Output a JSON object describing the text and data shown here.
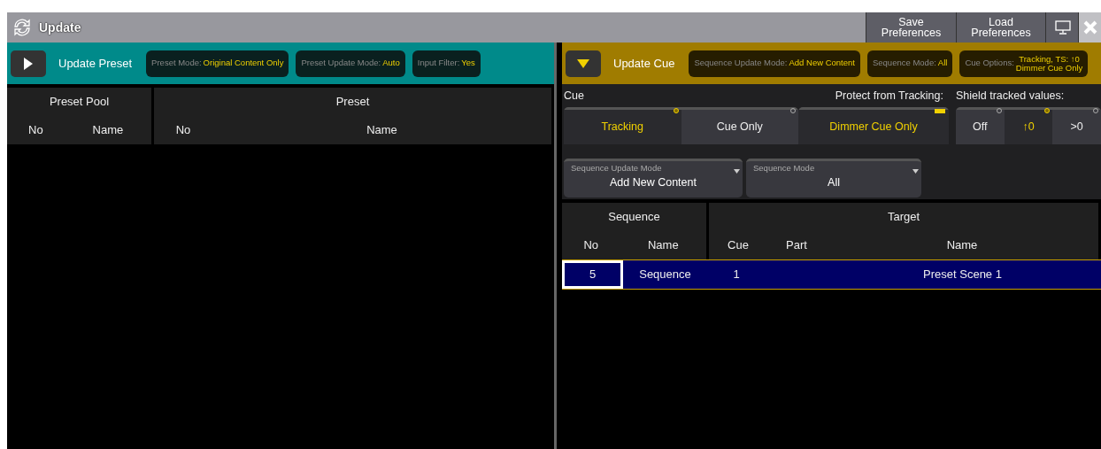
{
  "window": {
    "title": "Update",
    "buttons": [
      {
        "kind": "text",
        "label": "Save Preferences"
      },
      {
        "kind": "text",
        "label": "Load Preferences"
      },
      {
        "kind": "monitor"
      },
      {
        "kind": "close"
      }
    ]
  },
  "preset_panel": {
    "title": "Update Preset",
    "expanded": false,
    "chips": [
      {
        "label": "Preset Mode:",
        "value": "Original Content Only"
      },
      {
        "label": "Preset Update Mode:",
        "value": "Auto"
      },
      {
        "label": "Input Filter:",
        "value": "Yes"
      }
    ],
    "table": {
      "groups": [
        {
          "title": "Preset Pool",
          "columns": [
            "No",
            "Name"
          ]
        },
        {
          "title": "Preset",
          "columns": [
            "No",
            "Name"
          ]
        }
      ]
    }
  },
  "cue_panel": {
    "title": "Update Cue",
    "expanded": true,
    "chips": [
      {
        "label": "Sequence Update Mode:",
        "value": "Add New Content"
      },
      {
        "label": "Sequence Mode:",
        "value": "All"
      },
      {
        "label": "Cue Options:",
        "value": "Tracking, TS: ↑0",
        "value_2": "Dimmer Cue Only"
      }
    ],
    "cue": {
      "label": "Cue",
      "options": [
        {
          "label": "Tracking",
          "selected": true
        },
        {
          "label": "Cue Only",
          "selected": false
        }
      ]
    },
    "protect": {
      "label": "Protect from Tracking:",
      "option": "Dimmer Cue Only",
      "on": true
    },
    "shield": {
      "label": "Shield tracked values:",
      "options": [
        {
          "label": "Off",
          "selected": false
        },
        {
          "label": "↑0",
          "selected": true
        },
        {
          "label": ">0",
          "selected": false
        }
      ]
    },
    "dropdowns": [
      {
        "label": "Sequence Update Mode",
        "value": "Add New Content"
      },
      {
        "label": "Sequence Mode",
        "value": "All"
      }
    ],
    "table": {
      "groups": [
        {
          "title": "Sequence",
          "columns": [
            "No",
            "Name"
          ]
        },
        {
          "title": "Target",
          "columns": [
            "Cue",
            "Part",
            "Name"
          ]
        }
      ],
      "rows": [
        {
          "selected": true,
          "cells": [
            {
              "text": "5",
              "focused": true
            },
            {
              "text": "Sequence",
              "focused": false
            },
            {
              "text": "1",
              "focused": false
            },
            null,
            {
              "text": "Preset Scene 1",
              "focused": false
            }
          ]
        }
      ]
    }
  }
}
